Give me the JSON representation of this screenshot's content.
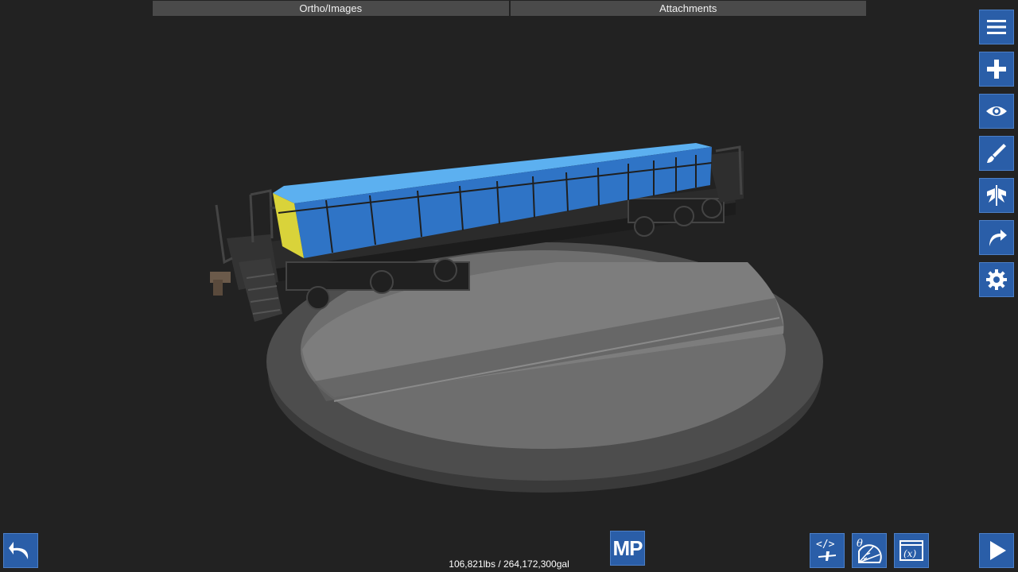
{
  "tabs": [
    {
      "label": "Ortho/Images"
    },
    {
      "label": "Attachments"
    }
  ],
  "toolbar_right": [
    {
      "icon": "menu-icon"
    },
    {
      "icon": "plus-icon"
    },
    {
      "icon": "eye-icon"
    },
    {
      "icon": "paint-brush-icon"
    },
    {
      "icon": "symmetry-icon"
    },
    {
      "icon": "rotate-icon"
    },
    {
      "icon": "gear-icon"
    }
  ],
  "bottom": {
    "mp_label": "MP",
    "stats": "106,821lbs / 264,172,300gal",
    "icons": [
      "undo-icon",
      "code-aircraft-icon",
      "theta-gauge-icon",
      "variables-icon",
      "play-icon"
    ]
  },
  "colors": {
    "background": "#222222",
    "button": "#2a5ea8",
    "tab": "#4a4a4a",
    "part_blue": "#2f74c6",
    "part_top": "#5cb0f0",
    "part_yellow": "#d9d33a"
  }
}
